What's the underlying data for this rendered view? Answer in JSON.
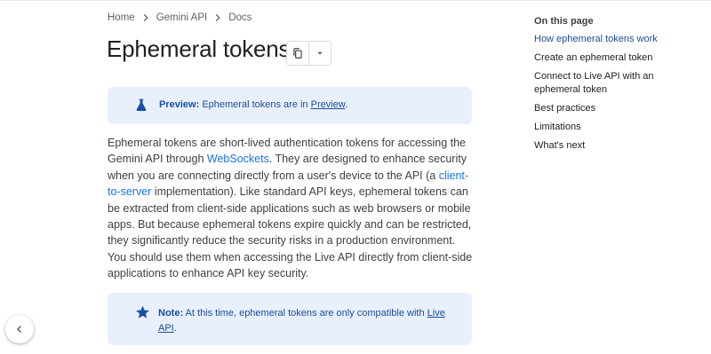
{
  "breadcrumb": [
    {
      "label": "Home"
    },
    {
      "label": "Gemini API"
    },
    {
      "label": "Docs"
    }
  ],
  "page": {
    "title": "Ephemeral tokens"
  },
  "preview_callout": {
    "label": "Preview:",
    "text": "Ephemeral tokens are in ",
    "link": "Preview",
    "end": "."
  },
  "paragraph": {
    "p1": "Ephemeral tokens are short-lived authentication tokens for accessing the Gemini API through ",
    "link1": "WebSockets",
    "p2": ". They are designed to enhance security when you are connecting directly from a user's device to the API (a ",
    "link2": "client-to-server",
    "p3": " implementation). Like standard API keys, ephemeral tokens can be extracted from client-side applications such as web browsers or mobile apps. But because ephemeral tokens expire quickly and can be restricted, they significantly reduce the security risks in a production environment. You should use them when accessing the Live API directly from client-side applications to enhance API key security."
  },
  "note_callout": {
    "label": "Note:",
    "text": " At this time, ephemeral tokens are only compatible with ",
    "link": "Live API",
    "end": "."
  },
  "toc": {
    "title": "On this page",
    "items": [
      {
        "label": "How ephemeral tokens work"
      },
      {
        "label": "Create an ephemeral token"
      },
      {
        "label": "Connect to Live API with an ephemeral token"
      },
      {
        "label": "Best practices"
      },
      {
        "label": "Limitations"
      },
      {
        "label": "What's next"
      }
    ]
  },
  "icons": {
    "copy": "copy-icon",
    "dropdown": "caret-down-icon",
    "preview": "flask-icon",
    "note": "star-icon",
    "collapse": "chevron-left-icon",
    "separator": "chevron-right-icon"
  },
  "colors": {
    "callout_bg": "#e8f0fe",
    "link": "#1a73e8",
    "accent": "#1a4c9c"
  }
}
